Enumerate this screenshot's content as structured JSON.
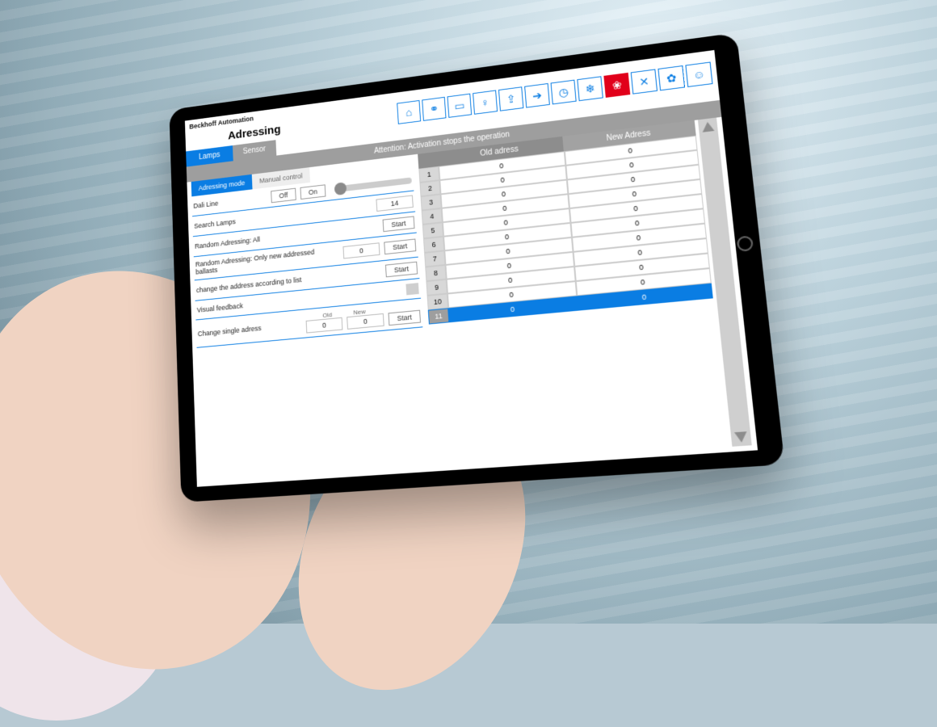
{
  "brand": "Beckhoff Automation",
  "title": "Adressing",
  "seg": {
    "a": "Lamps",
    "b": "Sensor"
  },
  "icons": [
    "home-icon",
    "users-icon",
    "card-icon",
    "bulb-icon",
    "walk-icon",
    "run-icon",
    "clock-icon",
    "snow-icon",
    "leaf-icon",
    "tools-icon",
    "bell-icon",
    "person-icon"
  ],
  "redIconIndex": 8,
  "warn": "Attention: Activation stops the operation",
  "subtabs": {
    "a": "Adressing mode",
    "b": "Manual control"
  },
  "rows": {
    "dali": {
      "label": "Dali Line",
      "off": "Off",
      "on": "On"
    },
    "search": {
      "label": "Search Lamps",
      "value": "14"
    },
    "randAll": {
      "label": "Random Adressing: All",
      "btn": "Start"
    },
    "randNew": {
      "label": "Random Adressing: Only new addressed ballasts",
      "value": "0",
      "btn": "Start"
    },
    "change": {
      "label": "change the address according to list",
      "btn": "Start"
    },
    "visual": {
      "label": "Visual feedback"
    },
    "single": {
      "label": "Change single adress",
      "oldLab": "Old",
      "newLab": "New",
      "old": "0",
      "new": "0",
      "btn": "Start"
    }
  },
  "table": {
    "headers": {
      "old": "Old adress",
      "new": "New Adress"
    },
    "rows": [
      {
        "n": "1",
        "old": "0",
        "new": "0"
      },
      {
        "n": "2",
        "old": "0",
        "new": "0"
      },
      {
        "n": "3",
        "old": "0",
        "new": "0"
      },
      {
        "n": "4",
        "old": "0",
        "new": "0"
      },
      {
        "n": "5",
        "old": "0",
        "new": "0"
      },
      {
        "n": "6",
        "old": "0",
        "new": "0"
      },
      {
        "n": "7",
        "old": "0",
        "new": "0"
      },
      {
        "n": "8",
        "old": "0",
        "new": "0"
      },
      {
        "n": "9",
        "old": "0",
        "new": "0"
      },
      {
        "n": "10",
        "old": "0",
        "new": "0"
      },
      {
        "n": "11",
        "old": "0",
        "new": "0"
      }
    ],
    "selected": 10
  }
}
